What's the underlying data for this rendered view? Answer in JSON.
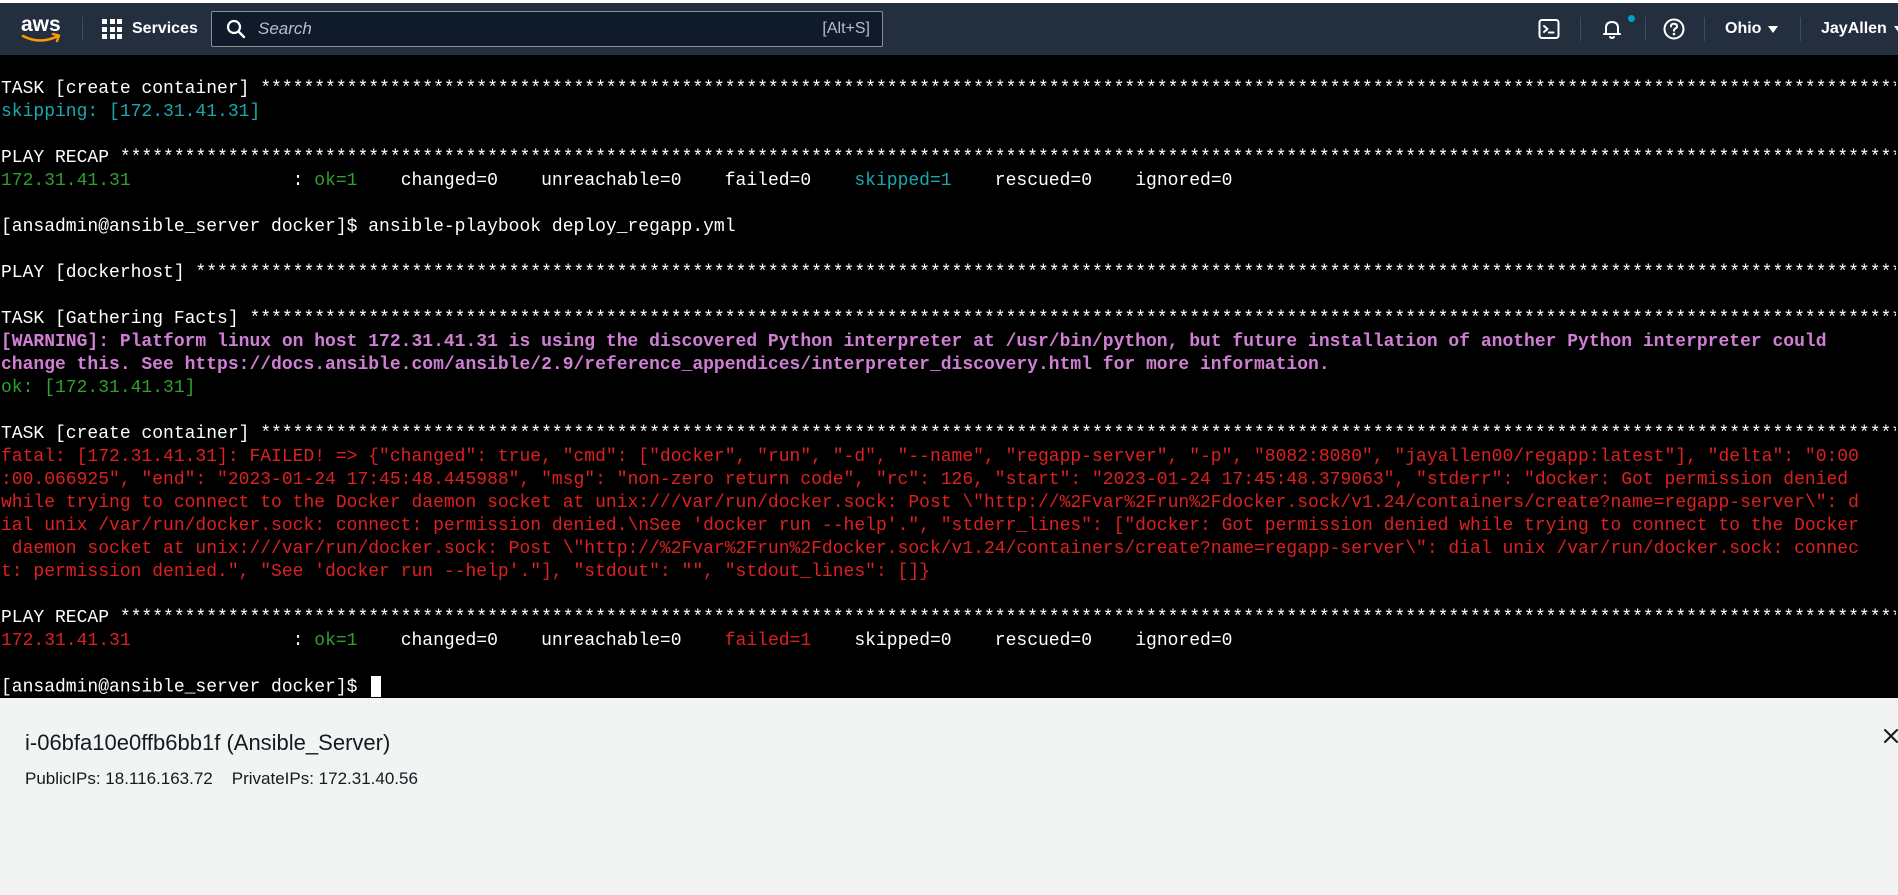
{
  "nav": {
    "logo_text": "aws",
    "services_label": "Services",
    "search_placeholder": "Search",
    "search_shortcut": "[Alt+S]",
    "region": "Ohio",
    "user": "JayAllen"
  },
  "terminal": {
    "lines": [
      [
        {
          "t": "TASK [create container] **********************************************************************************************************************************************************************",
          "c": "white"
        }
      ],
      [
        {
          "t": "skipping: [172.31.41.31]",
          "c": "cyan"
        }
      ],
      [],
      [
        {
          "t": "PLAY RECAP ***********************************************************************************************************************************************************************************",
          "c": "white"
        }
      ],
      [
        {
          "t": "172.31.41.31",
          "c": "green"
        },
        {
          "t": "               : ",
          "c": "white"
        },
        {
          "t": "ok=1",
          "c": "green"
        },
        {
          "t": "    changed=0    unreachable=0    failed=0    ",
          "c": "white"
        },
        {
          "t": "skipped=1",
          "c": "cyan"
        },
        {
          "t": "    rescued=0    ignored=0",
          "c": "white"
        }
      ],
      [],
      [
        {
          "t": "[ansadmin@ansible_server docker]$ ansible-playbook deploy_regapp.yml",
          "c": "white"
        }
      ],
      [],
      [
        {
          "t": "PLAY [dockerhost] ****************************************************************************************************************************************************************************",
          "c": "white"
        }
      ],
      [],
      [
        {
          "t": "TASK [Gathering Facts] ***********************************************************************************************************************************************************************",
          "c": "white"
        }
      ],
      [
        {
          "t": "[WARNING]: Platform linux on host 172.31.41.31 is using the discovered Python interpreter at /usr/bin/python, but future installation of another Python interpreter could",
          "c": "magenta"
        }
      ],
      [
        {
          "t": "change this. See https://docs.ansible.com/ansible/2.9/reference_appendices/interpreter_discovery.html for more information.",
          "c": "magenta"
        }
      ],
      [
        {
          "t": "ok: [172.31.41.31]",
          "c": "green"
        }
      ],
      [],
      [
        {
          "t": "TASK [create container] **********************************************************************************************************************************************************************",
          "c": "white"
        }
      ],
      [
        {
          "t": "fatal: [172.31.41.31]: FAILED! => {\"changed\": true, \"cmd\": [\"docker\", \"run\", \"-d\", \"--name\", \"regapp-server\", \"-p\", \"8082:8080\", \"jayallen00/regapp:latest\"], \"delta\": \"0:00",
          "c": "red"
        }
      ],
      [
        {
          "t": ":00.066925\", \"end\": \"2023-01-24 17:45:48.445988\", \"msg\": \"non-zero return code\", \"rc\": 126, \"start\": \"2023-01-24 17:45:48.379063\", \"stderr\": \"docker: Got permission denied",
          "c": "red"
        }
      ],
      [
        {
          "t": "while trying to connect to the Docker daemon socket at unix:///var/run/docker.sock: Post \\\"http://%2Fvar%2Frun%2Fdocker.sock/v1.24/containers/create?name=regapp-server\\\": d",
          "c": "red"
        }
      ],
      [
        {
          "t": "ial unix /var/run/docker.sock: connect: permission denied.\\nSee 'docker run --help'.\", \"stderr_lines\": [\"docker: Got permission denied while trying to connect to the Docker",
          "c": "red"
        }
      ],
      [
        {
          "t": " daemon socket at unix:///var/run/docker.sock: Post \\\"http://%2Fvar%2Frun%2Fdocker.sock/v1.24/containers/create?name=regapp-server\\\": dial unix /var/run/docker.sock: connec",
          "c": "red"
        }
      ],
      [
        {
          "t": "t: permission denied.\", \"See 'docker run --help'.\"], \"stdout\": \"\", \"stdout_lines\": []}",
          "c": "red"
        }
      ],
      [],
      [
        {
          "t": "PLAY RECAP ***********************************************************************************************************************************************************************************",
          "c": "white"
        }
      ],
      [
        {
          "t": "172.31.41.31",
          "c": "red"
        },
        {
          "t": "               : ",
          "c": "white"
        },
        {
          "t": "ok=1",
          "c": "green"
        },
        {
          "t": "    changed=0    unreachable=0    ",
          "c": "white"
        },
        {
          "t": "failed=1",
          "c": "red"
        },
        {
          "t": "    skipped=0    rescued=0    ignored=0",
          "c": "white"
        }
      ],
      [],
      [
        {
          "t": "[ansadmin@ansible_server docker]$ ",
          "c": "white"
        }
      ]
    ],
    "colors": {
      "white": "#ffffff",
      "cyan": "#19a8b0",
      "green": "#2fa12c",
      "red": "#dd2020",
      "magenta": "#d07fd4"
    }
  },
  "instance": {
    "title": "i-06bfa10e0ffb6bb1f (Ansible_Server)",
    "public_ips": "PublicIPs: 18.116.163.72",
    "private_ips": "PrivateIPs: 172.31.40.56"
  }
}
